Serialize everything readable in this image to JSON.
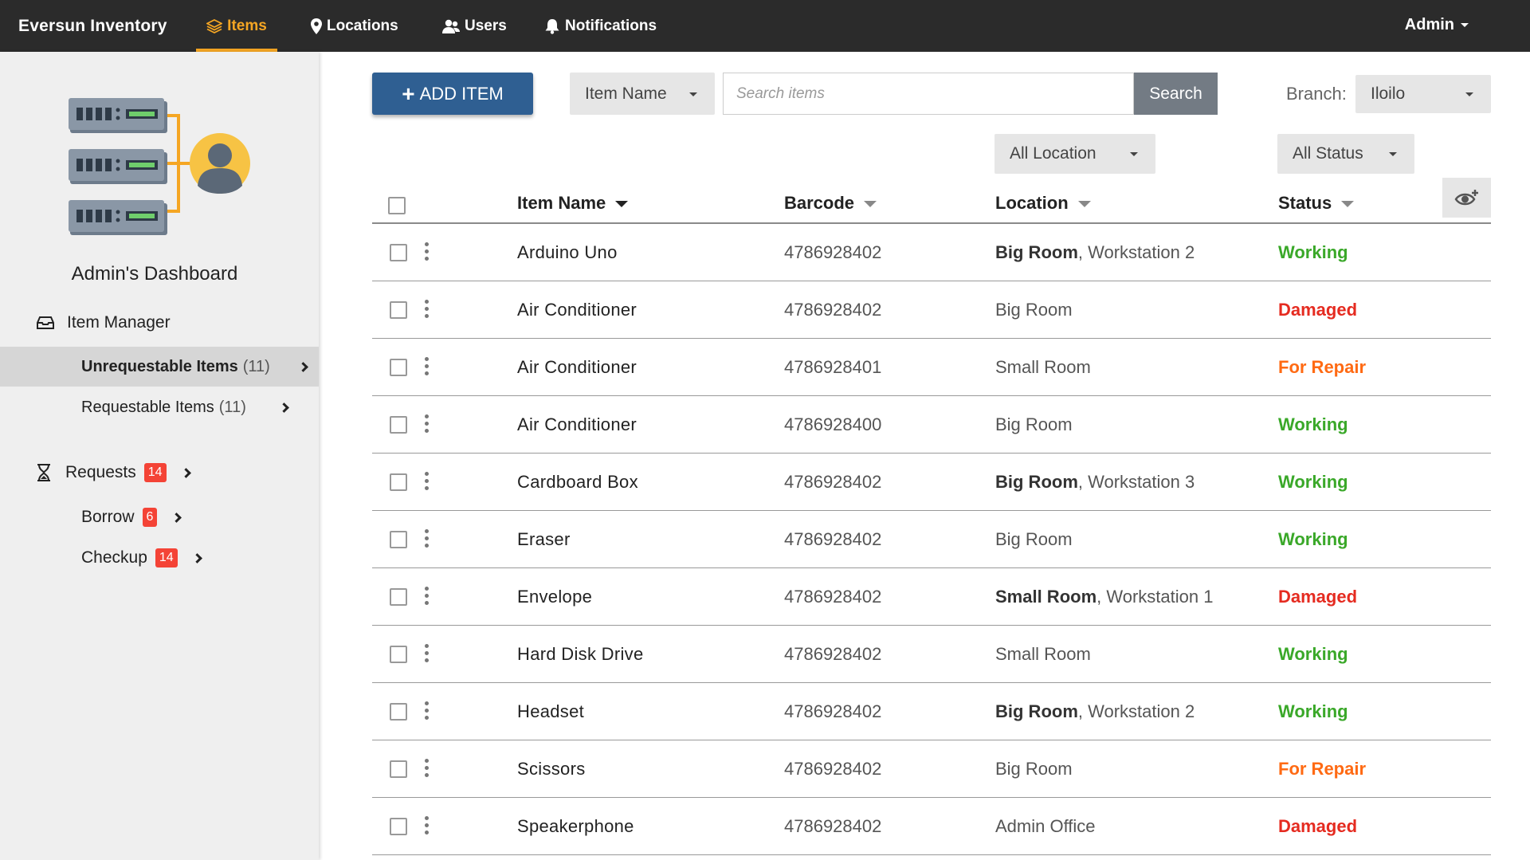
{
  "nav": {
    "brand": "Eversun Inventory",
    "items": "Items",
    "locations": "Locations",
    "users": "Users",
    "notifications": "Notifications",
    "admin": "Admin"
  },
  "sidebar": {
    "title": "Admin's Dashboard",
    "item_manager": "Item Manager",
    "unrequestable": "Unrequestable Items",
    "unrequestable_count": "(11)",
    "requestable": "Requestable Items",
    "requestable_count": "(11)",
    "requests": "Requests",
    "requests_badge": "14",
    "borrow": "Borrow",
    "borrow_badge": "6",
    "checkup": "Checkup",
    "checkup_badge": "14"
  },
  "toolbar": {
    "add_label": "ADD ITEM",
    "filter_field": "Item Name",
    "search_placeholder": "Search items",
    "search_label": "Search",
    "branch_label": "Branch:",
    "branch_value": "Iloilo",
    "location_filter": "All Location",
    "status_filter": "All Status"
  },
  "table": {
    "headers": {
      "name": "Item Name",
      "barcode": "Barcode",
      "location": "Location",
      "status": "Status"
    },
    "rows": [
      {
        "name": "Arduino Uno",
        "barcode": "4786928402",
        "room": "Big Room",
        "station": ", Workstation 2",
        "status": "Working",
        "status_color": "#3aa829"
      },
      {
        "name": "Air Conditioner",
        "barcode": "4786928402",
        "room": "Big Room",
        "station": "",
        "status": "Damaged",
        "status_color": "#e52b20"
      },
      {
        "name": "Air Conditioner",
        "barcode": "4786928401",
        "room": "Small Room",
        "station": "",
        "status": "For Repair",
        "status_color": "#ff6a13"
      },
      {
        "name": "Air Conditioner",
        "barcode": "4786928400",
        "room": "Big Room",
        "station": "",
        "status": "Working",
        "status_color": "#3aa829"
      },
      {
        "name": "Cardboard Box",
        "barcode": "4786928402",
        "room": "Big Room",
        "station": ", Workstation 3",
        "status": "Working",
        "status_color": "#3aa829"
      },
      {
        "name": "Eraser",
        "barcode": "4786928402",
        "room": "Big Room",
        "station": "",
        "status": "Working",
        "status_color": "#3aa829"
      },
      {
        "name": "Envelope",
        "barcode": "4786928402",
        "room": "Small Room",
        "station": ", Workstation 1",
        "status": "Damaged",
        "status_color": "#e52b20"
      },
      {
        "name": "Hard Disk Drive",
        "barcode": "4786928402",
        "room": "Small Room",
        "station": "",
        "status": "Working",
        "status_color": "#3aa829"
      },
      {
        "name": "Headset",
        "barcode": "4786928402",
        "room": "Big Room",
        "station": ", Workstation 2",
        "status": "Working",
        "status_color": "#3aa829"
      },
      {
        "name": "Scissors",
        "barcode": "4786928402",
        "room": "Big Room",
        "station": "",
        "status": "For Repair",
        "status_color": "#ff6a13"
      },
      {
        "name": "Speakerphone",
        "barcode": "4786928402",
        "room": "Admin Office",
        "station": "",
        "status": "Damaged",
        "status_color": "#e52b20"
      }
    ]
  }
}
